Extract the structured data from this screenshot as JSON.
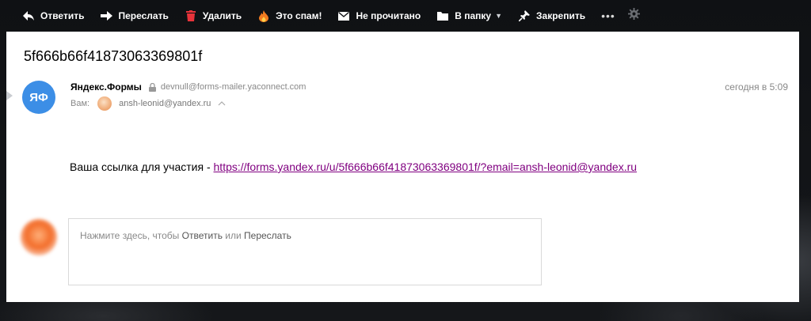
{
  "toolbar": {
    "reply_label": "Ответить",
    "forward_label": "Переслать",
    "delete_label": "Удалить",
    "spam_label": "Это спам!",
    "unread_label": "Не прочитано",
    "folder_label": "В папку",
    "pin_label": "Закрепить",
    "more_label": "•••"
  },
  "message": {
    "subject": "5f666b66f41873063369801f",
    "sender": {
      "avatar_initials": "ЯФ",
      "name": "Яндекс.Формы",
      "email": "devnull@forms-mailer.yaconnect.com"
    },
    "time": "сегодня в 5:09",
    "to": {
      "label": "Вам:",
      "email": "ansh-leonid@yandex.ru"
    },
    "body": {
      "prefix": "Ваша ссылка для участия - ",
      "link": "https://forms.yandex.ru/u/5f666b66f41873063369801f/?email=ansh-leonid@yandex.ru"
    }
  },
  "reply": {
    "hint_prefix": "Нажмите здесь, чтобы ",
    "reply_action": "Ответить",
    "or_text": " или ",
    "forward_action": "Переслать"
  },
  "colors": {
    "toolbar_bg": "#0e1013",
    "delete_icon": "#e8333a",
    "spam_icon": "#f27b20",
    "avatar_bg": "#3c8ee6",
    "link": "#800080"
  },
  "icons": {
    "reply": "reply-arrow-icon",
    "forward": "forward-arrow-icon",
    "delete": "trash-icon",
    "spam": "flame-icon",
    "unread": "envelope-icon",
    "folder": "folder-icon",
    "pin": "pin-icon",
    "settings": "gear-icon"
  }
}
